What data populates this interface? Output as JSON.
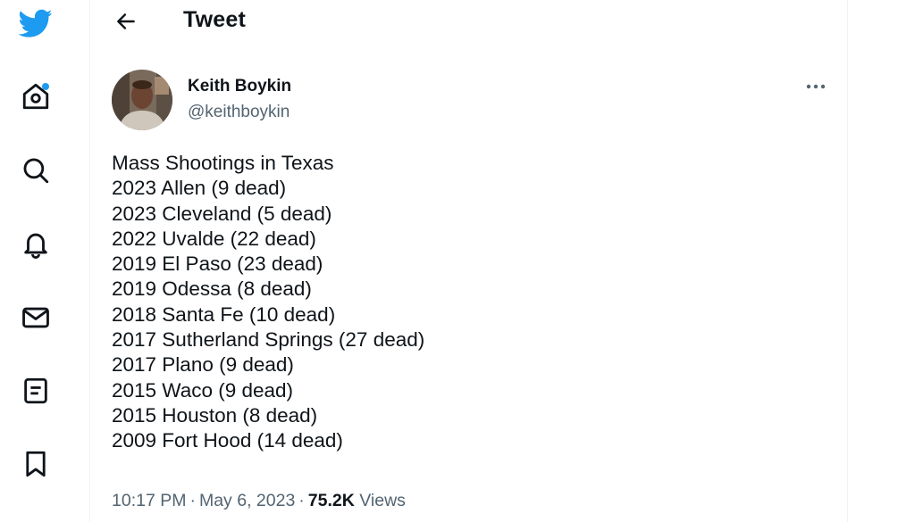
{
  "nav": {
    "items": [
      {
        "icon": "twitter-bird-icon",
        "color": "#1d9bf0"
      },
      {
        "icon": "home-icon",
        "has_notification_dot": true
      },
      {
        "icon": "search-icon"
      },
      {
        "icon": "bell-icon"
      },
      {
        "icon": "mail-icon"
      },
      {
        "icon": "lists-icon"
      },
      {
        "icon": "bookmark-icon"
      }
    ]
  },
  "header": {
    "back_icon": "arrow-left-icon",
    "title": "Tweet"
  },
  "tweet": {
    "author": {
      "name": "Keith Boykin",
      "handle": "@keithboykin"
    },
    "more_icon": "more-horizontal-icon",
    "lines": [
      "Mass Shootings in Texas",
      "2023 Allen (9 dead)",
      "2023 Cleveland (5 dead)",
      "2022 Uvalde (22 dead)",
      "2019 El Paso (23 dead)",
      "2019 Odessa (8 dead)",
      "2018 Santa Fe (10 dead)",
      "2017 Sutherland Springs (27 dead)",
      "2017 Plano (9 dead)",
      "2015 Waco (9 dead)",
      "2015 Houston (8 dead)",
      "2009 Fort Hood (14 dead)"
    ],
    "time": "10:17 PM",
    "date": "May 6, 2023",
    "separator": "·",
    "views_count": "75.2K",
    "views_label": "Views"
  },
  "colors": {
    "accent": "#1d9bf0",
    "text": "#0f1419",
    "secondary": "#536471",
    "border": "#eff3f4"
  }
}
